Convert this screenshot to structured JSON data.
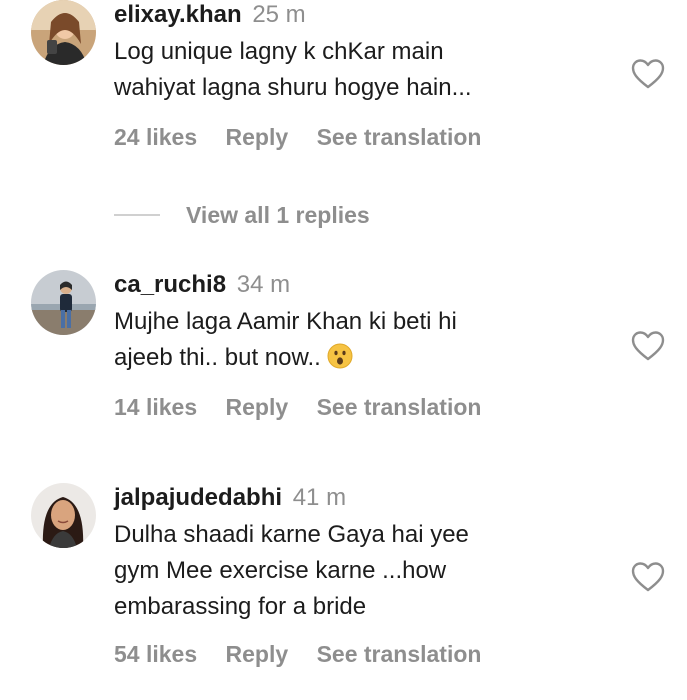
{
  "comments": [
    {
      "username": "elixay.khan",
      "time": "25 m",
      "text_line1": "Log unique lagny k chKar main",
      "text_line2": "wahiyat lagna shuru hogye hain...",
      "likes": "24 likes",
      "reply": "Reply",
      "translate": "See translation",
      "avatar_icon": "user-photo"
    },
    {
      "username": "ca_ruchi8",
      "time": "34 m",
      "text_line1": "Mujhe laga Aamir Khan ki beti hi",
      "text_line2": "ajeeb thi.. but now..",
      "emoji": "surprised-face-emoji",
      "likes": "14 likes",
      "reply": "Reply",
      "translate": "See translation",
      "avatar_icon": "user-photo"
    },
    {
      "username": "jalpajudedabhi",
      "time": "41 m",
      "text_line1": "Dulha shaadi karne Gaya hai yee",
      "text_line2": "gym Mee exercise karne ...how",
      "text_line3": "embarassing for a bride",
      "likes": "54 likes",
      "reply": "Reply",
      "translate": "See translation",
      "avatar_icon": "user-photo"
    }
  ],
  "replies_toggle": "View all 1 replies",
  "icons": {
    "like": "heart-outline-icon"
  },
  "colors": {
    "text": "#1c1c1c",
    "muted": "#8e8e8e",
    "background": "#ffffff"
  }
}
